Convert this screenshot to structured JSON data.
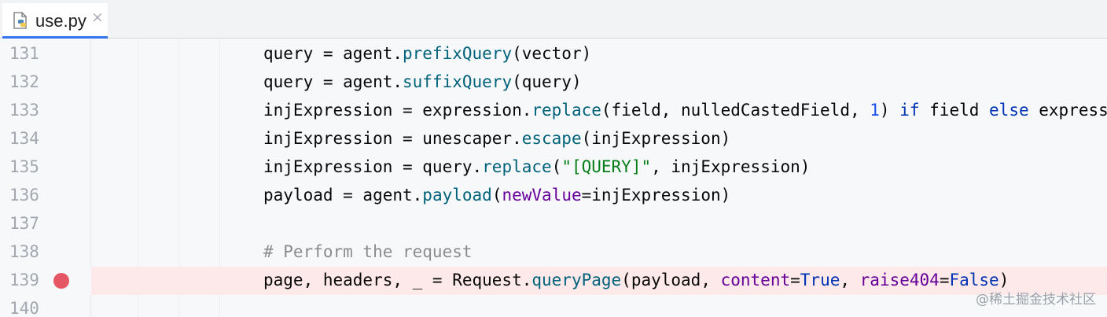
{
  "tab": {
    "file_name": "use.py",
    "file_icon": "python-file-icon",
    "close_glyph": "×",
    "accent_color": "#3574f0"
  },
  "editor": {
    "breakpoint_color": "#e55765",
    "lines": [
      {
        "number": "131",
        "breakpoint": false,
        "tokens": [
          [
            "query = agent.",
            ""
          ],
          [
            "prefixQuery",
            "fn"
          ],
          [
            "(vector)",
            ""
          ]
        ]
      },
      {
        "number": "132",
        "breakpoint": false,
        "tokens": [
          [
            "query = agent.",
            ""
          ],
          [
            "suffixQuery",
            "fn"
          ],
          [
            "(query)",
            ""
          ]
        ]
      },
      {
        "number": "133",
        "breakpoint": false,
        "tokens": [
          [
            "injExpression = expression.",
            ""
          ],
          [
            "replace",
            "fn"
          ],
          [
            "(field, nulledCastedField, ",
            ""
          ],
          [
            "1",
            "num"
          ],
          [
            ") ",
            ""
          ],
          [
            "if",
            "kw"
          ],
          [
            " field ",
            ""
          ],
          [
            "else",
            "kw"
          ],
          [
            " expression",
            ""
          ]
        ]
      },
      {
        "number": "134",
        "breakpoint": false,
        "tokens": [
          [
            "injExpression = unescaper.",
            ""
          ],
          [
            "escape",
            "fn"
          ],
          [
            "(injExpression)",
            ""
          ]
        ]
      },
      {
        "number": "135",
        "breakpoint": false,
        "tokens": [
          [
            "injExpression = query.",
            ""
          ],
          [
            "replace",
            "fn"
          ],
          [
            "(",
            ""
          ],
          [
            "\"[QUERY]\"",
            "str"
          ],
          [
            ", injExpression)",
            ""
          ]
        ]
      },
      {
        "number": "136",
        "breakpoint": false,
        "tokens": [
          [
            "payload = agent.",
            ""
          ],
          [
            "payload",
            "fn"
          ],
          [
            "(",
            ""
          ],
          [
            "newValue",
            "kwarg"
          ],
          [
            "=injExpression)",
            ""
          ]
        ]
      },
      {
        "number": "137",
        "breakpoint": false,
        "tokens": []
      },
      {
        "number": "138",
        "breakpoint": false,
        "tokens": [
          [
            "# Perform the request",
            "cmt"
          ]
        ]
      },
      {
        "number": "139",
        "breakpoint": true,
        "tokens": [
          [
            "page, headers, _ = Request.",
            ""
          ],
          [
            "queryPage",
            "fn"
          ],
          [
            "(payload, ",
            ""
          ],
          [
            "content",
            "kwarg"
          ],
          [
            "=",
            ""
          ],
          [
            "True",
            "kw"
          ],
          [
            ", ",
            ""
          ],
          [
            "raise404",
            "kwarg"
          ],
          [
            "=",
            ""
          ],
          [
            "False",
            "kw"
          ],
          [
            ")",
            ""
          ]
        ]
      },
      {
        "number": "140",
        "breakpoint": false,
        "tokens": []
      }
    ]
  },
  "watermark": "@稀土掘金技术社区"
}
